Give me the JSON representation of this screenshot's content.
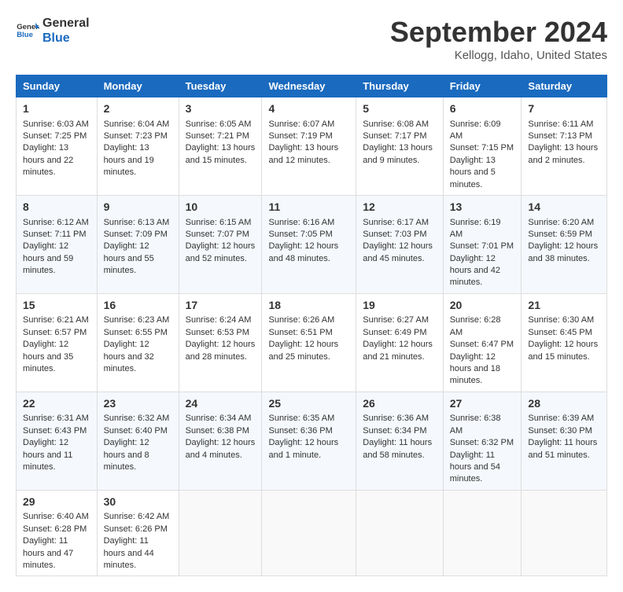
{
  "logo": {
    "line1": "General",
    "line2": "Blue"
  },
  "title": "September 2024",
  "location": "Kellogg, Idaho, United States",
  "headers": [
    "Sunday",
    "Monday",
    "Tuesday",
    "Wednesday",
    "Thursday",
    "Friday",
    "Saturday"
  ],
  "weeks": [
    [
      {
        "day": "1",
        "sunrise": "6:03 AM",
        "sunset": "7:25 PM",
        "daylight": "13 hours and 22 minutes."
      },
      {
        "day": "2",
        "sunrise": "6:04 AM",
        "sunset": "7:23 PM",
        "daylight": "13 hours and 19 minutes."
      },
      {
        "day": "3",
        "sunrise": "6:05 AM",
        "sunset": "7:21 PM",
        "daylight": "13 hours and 15 minutes."
      },
      {
        "day": "4",
        "sunrise": "6:07 AM",
        "sunset": "7:19 PM",
        "daylight": "13 hours and 12 minutes."
      },
      {
        "day": "5",
        "sunrise": "6:08 AM",
        "sunset": "7:17 PM",
        "daylight": "13 hours and 9 minutes."
      },
      {
        "day": "6",
        "sunrise": "6:09 AM",
        "sunset": "7:15 PM",
        "daylight": "13 hours and 5 minutes."
      },
      {
        "day": "7",
        "sunrise": "6:11 AM",
        "sunset": "7:13 PM",
        "daylight": "13 hours and 2 minutes."
      }
    ],
    [
      {
        "day": "8",
        "sunrise": "6:12 AM",
        "sunset": "7:11 PM",
        "daylight": "12 hours and 59 minutes."
      },
      {
        "day": "9",
        "sunrise": "6:13 AM",
        "sunset": "7:09 PM",
        "daylight": "12 hours and 55 minutes."
      },
      {
        "day": "10",
        "sunrise": "6:15 AM",
        "sunset": "7:07 PM",
        "daylight": "12 hours and 52 minutes."
      },
      {
        "day": "11",
        "sunrise": "6:16 AM",
        "sunset": "7:05 PM",
        "daylight": "12 hours and 48 minutes."
      },
      {
        "day": "12",
        "sunrise": "6:17 AM",
        "sunset": "7:03 PM",
        "daylight": "12 hours and 45 minutes."
      },
      {
        "day": "13",
        "sunrise": "6:19 AM",
        "sunset": "7:01 PM",
        "daylight": "12 hours and 42 minutes."
      },
      {
        "day": "14",
        "sunrise": "6:20 AM",
        "sunset": "6:59 PM",
        "daylight": "12 hours and 38 minutes."
      }
    ],
    [
      {
        "day": "15",
        "sunrise": "6:21 AM",
        "sunset": "6:57 PM",
        "daylight": "12 hours and 35 minutes."
      },
      {
        "day": "16",
        "sunrise": "6:23 AM",
        "sunset": "6:55 PM",
        "daylight": "12 hours and 32 minutes."
      },
      {
        "day": "17",
        "sunrise": "6:24 AM",
        "sunset": "6:53 PM",
        "daylight": "12 hours and 28 minutes."
      },
      {
        "day": "18",
        "sunrise": "6:26 AM",
        "sunset": "6:51 PM",
        "daylight": "12 hours and 25 minutes."
      },
      {
        "day": "19",
        "sunrise": "6:27 AM",
        "sunset": "6:49 PM",
        "daylight": "12 hours and 21 minutes."
      },
      {
        "day": "20",
        "sunrise": "6:28 AM",
        "sunset": "6:47 PM",
        "daylight": "12 hours and 18 minutes."
      },
      {
        "day": "21",
        "sunrise": "6:30 AM",
        "sunset": "6:45 PM",
        "daylight": "12 hours and 15 minutes."
      }
    ],
    [
      {
        "day": "22",
        "sunrise": "6:31 AM",
        "sunset": "6:43 PM",
        "daylight": "12 hours and 11 minutes."
      },
      {
        "day": "23",
        "sunrise": "6:32 AM",
        "sunset": "6:40 PM",
        "daylight": "12 hours and 8 minutes."
      },
      {
        "day": "24",
        "sunrise": "6:34 AM",
        "sunset": "6:38 PM",
        "daylight": "12 hours and 4 minutes."
      },
      {
        "day": "25",
        "sunrise": "6:35 AM",
        "sunset": "6:36 PM",
        "daylight": "12 hours and 1 minute."
      },
      {
        "day": "26",
        "sunrise": "6:36 AM",
        "sunset": "6:34 PM",
        "daylight": "11 hours and 58 minutes."
      },
      {
        "day": "27",
        "sunrise": "6:38 AM",
        "sunset": "6:32 PM",
        "daylight": "11 hours and 54 minutes."
      },
      {
        "day": "28",
        "sunrise": "6:39 AM",
        "sunset": "6:30 PM",
        "daylight": "11 hours and 51 minutes."
      }
    ],
    [
      {
        "day": "29",
        "sunrise": "6:40 AM",
        "sunset": "6:28 PM",
        "daylight": "11 hours and 47 minutes."
      },
      {
        "day": "30",
        "sunrise": "6:42 AM",
        "sunset": "6:26 PM",
        "daylight": "11 hours and 44 minutes."
      },
      null,
      null,
      null,
      null,
      null
    ]
  ],
  "labels": {
    "sunrise": "Sunrise:",
    "sunset": "Sunset:",
    "daylight": "Daylight:"
  }
}
